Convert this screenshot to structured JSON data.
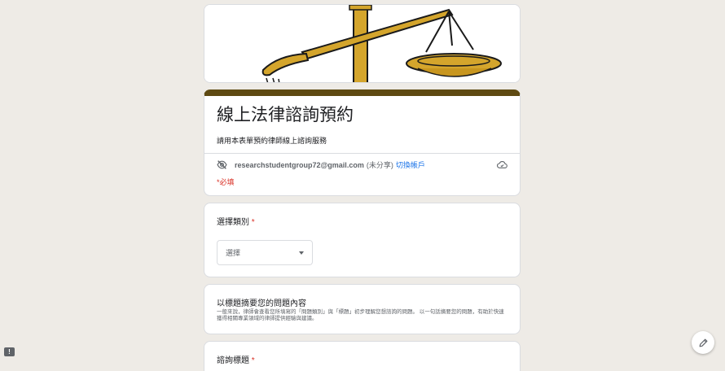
{
  "form": {
    "title": "線上法律諮詢預約",
    "description": "請用本表單預約律師線上諮詢服務",
    "account_email": "researchstudentgroup72@gmail.com",
    "account_note": "(未分享)",
    "switch_account": "切換帳戶",
    "required_note": "*必填"
  },
  "questions": {
    "category_label": "選擇類別",
    "category_required": "*",
    "category_placeholder": "選擇",
    "summary_title": "以標題摘要您的問題內容",
    "summary_desc": "一般來說，律師會查看您所填寫的「問題類別」與「標題」初步理解您想諮詢的問題。 以一句話摘要您的問題，有助於快速獲得相關專業領域的律師提供經驗與建議。",
    "subject_label": "諮詢標題",
    "subject_required": "*"
  },
  "icons": {
    "visibility": "eye-off-icon",
    "cloud": "cloud-done-icon",
    "edit": "pencil-icon",
    "report": "report-icon"
  },
  "colors": {
    "theme": "#5e4a12",
    "background": "#eeebe6",
    "required": "#d93025",
    "link": "#1a73e8",
    "scale_gold": "#d4a52c"
  }
}
